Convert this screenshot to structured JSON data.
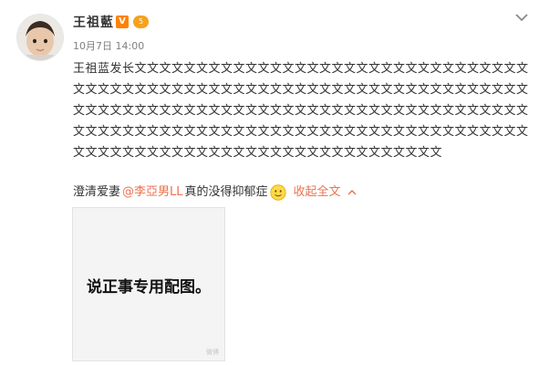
{
  "user": {
    "name": "王祖藍",
    "verified_badge": "V",
    "level_badge": "5",
    "post_time": "10月7日 14:00"
  },
  "post": {
    "text_main": "王祖蓝发长文文文文文文文文文文文文文文文文文文文文文文文文文文文文文文文文文文文文文文文文文文文文文文文文文文文文文文文文文文文文文文文文文文文文文文文文文文文文文文文文文文文文文文文文文文文文文文文文文文文文文文文文文文文文文文文文文文文文文文文文文文文文文文文文文文文文文文文文文文文文文文文文文文文文文文文文文文文文文文文文文文文文文文文文文文文文文",
    "last_line_pre": "澄清爱妻",
    "mention": "@李亞男LL",
    "last_line_post": "真的没得抑郁症",
    "collapse_label": "收起全文",
    "image_caption": "说正事专用配图。",
    "image_watermark": "微博"
  },
  "colors": {
    "accent": "#eb7350",
    "verified": "#ff8200",
    "level": "#f7a11d"
  },
  "icons": [
    "avatar",
    "verified-icon",
    "level-badge-icon",
    "chevron-down-icon",
    "smile-emoji-icon",
    "chevron-up-icon"
  ]
}
